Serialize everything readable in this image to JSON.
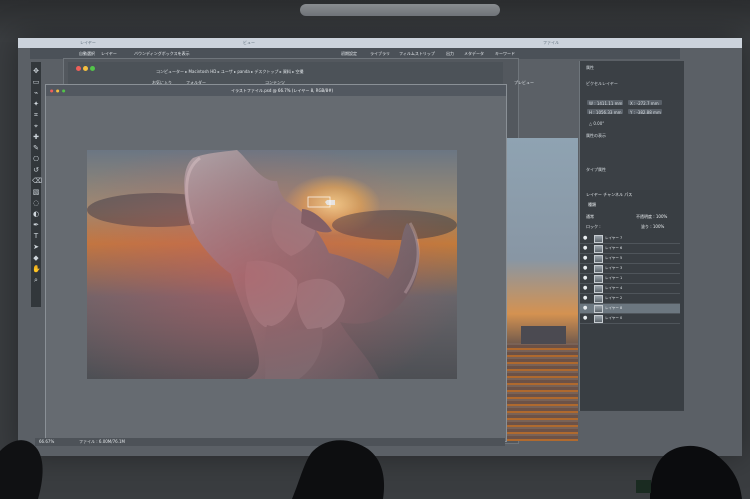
{
  "menubar": {
    "layer": "レイヤー",
    "view_label": "ビュー",
    "file_label": "ファイル"
  },
  "options": {
    "auto_select": "自動選択",
    "layer": "レイヤー",
    "bounding_box": "バウンディングボックスを表示",
    "essential": "初期設定",
    "library": "ライブラリ",
    "filmstrip": "フィルムストリップ",
    "output": "出力",
    "metadata": "メタデータ",
    "keywords": "キーワード"
  },
  "bridge": {
    "path": "コンピューター ▸ Macintosh HD ▸ ユーザ ▸ panda ▸ デスクトップ ▸ 資料 ▸ 空撮",
    "favorites": "お気に入り",
    "folder": "フォルダー",
    "content": "コンテンツ",
    "preview": "プレビュー"
  },
  "document": {
    "tab_title": "イラストファイル.psd @ 66.7% (レイヤー 8, RGB/8#)",
    "status_zoom": "66.67%",
    "status_file": "ファイル : 6.00M/76.1M"
  },
  "properties": {
    "title": "属性",
    "label": "ピクセルレイヤー",
    "w": "W : 1411.11 mm",
    "h": "H : 1056.33 mm",
    "x": "X : -272.7 mm",
    "y": "Y : -382.88 mm",
    "angle": "△ 0.00°",
    "appearance": "属性の表示",
    "type": "タイプ属性"
  },
  "layers": {
    "tabs": "レイヤー  チャンネル  パス",
    "search": "種類",
    "normal": "通常",
    "opacity": "不透明度 : 100%",
    "lock": "ロック :",
    "fill": "塗り : 100%",
    "items": [
      {
        "name": "レイヤー 7",
        "selected": false
      },
      {
        "name": "レイヤー 6",
        "selected": false
      },
      {
        "name": "レイヤー 5",
        "selected": false
      },
      {
        "name": "レイヤー 3",
        "selected": false
      },
      {
        "name": "レイヤー 1",
        "selected": false
      },
      {
        "name": "レイヤー 4",
        "selected": false
      },
      {
        "name": "レイヤー 2",
        "selected": false
      },
      {
        "name": "レイヤー 8",
        "selected": true
      },
      {
        "name": "レイヤー 0",
        "selected": false
      }
    ]
  },
  "colors": {
    "accent": "#5d8ec7",
    "selected": "#6c7780",
    "sunset": "#c27a3b"
  },
  "icons": {
    "toolbar": [
      "move-icon",
      "marquee-icon",
      "lasso-icon",
      "magic-wand-icon",
      "crop-icon",
      "eyedropper-icon",
      "healing-brush-icon",
      "brush-icon",
      "stamp-icon",
      "history-brush-icon",
      "eraser-icon",
      "gradient-icon",
      "blur-icon",
      "dodge-icon",
      "pen-icon",
      "type-icon",
      "path-select-icon",
      "shape-icon",
      "hand-icon",
      "zoom-icon"
    ]
  }
}
